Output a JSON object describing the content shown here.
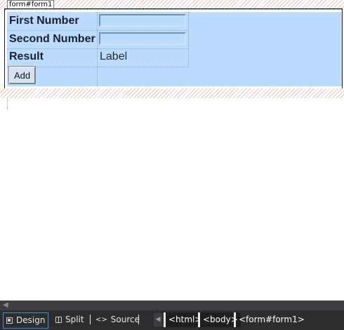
{
  "designer": {
    "form_tag": "form#form1",
    "rows": [
      {
        "label": "First Number"
      },
      {
        "label": "Second Number"
      },
      {
        "label": "Result",
        "value": "Label"
      }
    ],
    "add_button": "Add"
  },
  "statusbar": {
    "views": [
      "Design",
      "Split",
      "Source"
    ],
    "active_view": "Design",
    "breadcrumbs": [
      "<html>",
      "<body>",
      "<form#form1>"
    ]
  },
  "colors": {
    "table_bg": "#bcdcff",
    "statusbar_bg": "#2d2d30",
    "active_border": "#3b8fe0"
  }
}
